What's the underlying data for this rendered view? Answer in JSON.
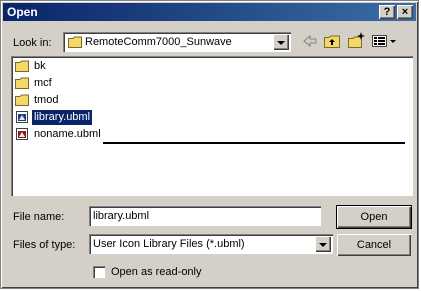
{
  "window": {
    "title": "Open",
    "help_label": "?",
    "close_label": "×"
  },
  "look_in": {
    "label": "Look in:",
    "value": "RemoteComm7000_Sunwave",
    "icon": "folder-icon"
  },
  "toolbar": {
    "icons": [
      "back-arrow-icon",
      "up-folder-icon",
      "new-folder-icon",
      "view-menu-icon"
    ]
  },
  "files": [
    {
      "name": "bk",
      "type": "folder",
      "selected": false
    },
    {
      "name": "mcf",
      "type": "folder",
      "selected": false
    },
    {
      "name": "tmod",
      "type": "folder",
      "selected": false
    },
    {
      "name": "library.ubml",
      "type": "file",
      "selected": true
    },
    {
      "name": "noname.ubml",
      "type": "file",
      "selected": false
    }
  ],
  "file_name": {
    "label": "File name:",
    "value": "library.ubml"
  },
  "files_of_type": {
    "label": "Files of type:",
    "value": "User Icon Library Files (*.ubml)"
  },
  "buttons": {
    "open": "Open",
    "cancel": "Cancel"
  },
  "read_only": {
    "label": "Open as read-only",
    "checked": false
  },
  "colors": {
    "title_bar": "#0a246a",
    "dialog_face": "#d4d0c8",
    "selection": "#0a246a",
    "folder": "#f5d86a"
  }
}
